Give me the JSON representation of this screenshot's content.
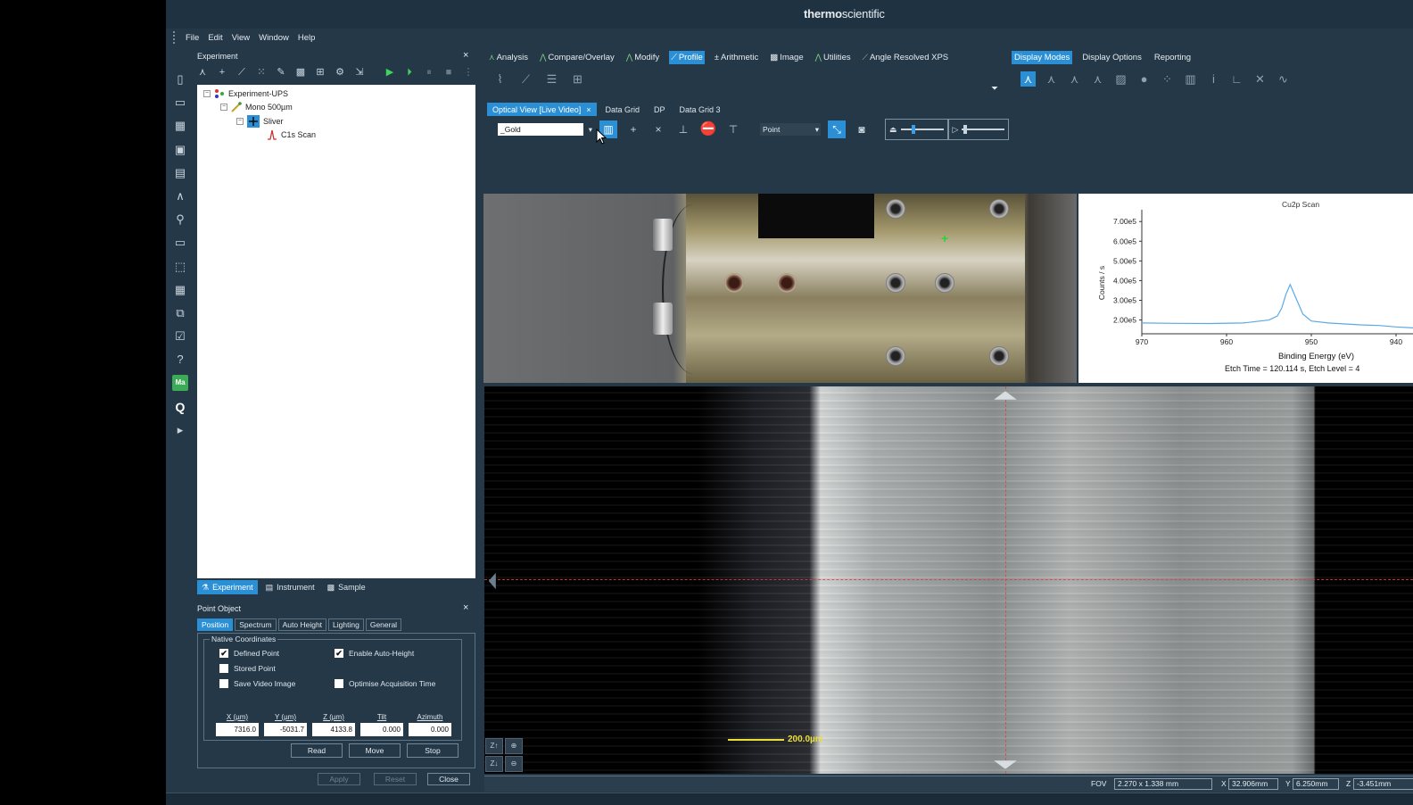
{
  "brand": {
    "part1": "thermo",
    "part2": "scientific"
  },
  "menu": [
    "File",
    "Edit",
    "View",
    "Window",
    "Help"
  ],
  "experiment_panel": {
    "title": "Experiment",
    "close": "×",
    "tree": [
      {
        "label": "Experiment-UPS"
      },
      {
        "label": "Mono 500µm"
      },
      {
        "label": "Sliver"
      },
      {
        "label": "C1s Scan"
      }
    ],
    "tabs": [
      "Experiment",
      "Instrument",
      "Sample"
    ]
  },
  "point_object": {
    "title": "Point Object",
    "close": "×",
    "tabs": [
      "Position",
      "Spectrum",
      "Auto Height",
      "Lighting",
      "General"
    ],
    "group_label": "Native Coordinates",
    "checkboxes": {
      "defined_point": {
        "label": "Defined Point",
        "checked": "✔"
      },
      "stored_point": {
        "label": "Stored Point",
        "checked": ""
      },
      "save_video_image": {
        "label": "Save Video Image",
        "checked": ""
      },
      "enable_auto_height": {
        "label": "Enable Auto-Height",
        "checked": "✔"
      },
      "optimise_acquisition": {
        "label": "Optimise Acquisition Time",
        "checked": ""
      }
    },
    "coords": [
      {
        "label": "X (µm)",
        "value": "7316.0"
      },
      {
        "label": "Y (µm)",
        "value": "-5031.7"
      },
      {
        "label": "Z (µm)",
        "value": "4133.8"
      },
      {
        "label": "Tilt",
        "value": "0.000"
      },
      {
        "label": "Azimuth",
        "value": "0.000"
      }
    ],
    "buttons": {
      "read": "Read",
      "move": "Move",
      "stop": "Stop",
      "apply": "Apply",
      "reset": "Reset",
      "close": "Close"
    }
  },
  "ribbon": {
    "tabs": [
      "Analysis",
      "Compare/Overlay",
      "Modify",
      "Profile",
      "Arithmetic",
      "Image",
      "Utilities",
      "Angle Resolved XPS"
    ],
    "active": "Profile",
    "right_tabs": [
      "Display Modes",
      "Display Options",
      "Reporting"
    ]
  },
  "doc_tabs": {
    "active": "Optical View [Live Video]",
    "close": "×",
    "others": [
      "Data Grid",
      "DP",
      "Data Grid 3"
    ]
  },
  "optical_toolbar": {
    "preset_value": "_Gold",
    "mode_value": "Point"
  },
  "scale_bar": {
    "label": "200.0µm"
  },
  "zoom_buttons": {
    "z_up": "Z↑",
    "z_down": "Z↓"
  },
  "status_bar": {
    "fov_label": "FOV",
    "fov_value": "2.270 x 1.338 mm",
    "x_label": "X",
    "x_value": "32.906mm",
    "y_label": "Y",
    "y_value": "6.250mm",
    "z_label": "Z",
    "z_value": "-3.451mm"
  },
  "chart_data": {
    "type": "line",
    "title": "Cu2p Scan",
    "xlabel": "Binding Energy (eV)",
    "ylabel": "Counts / s",
    "subtitle": "Etch Time = 120.114 s, Etch Level = 4",
    "x_ticks": [
      "970",
      "960",
      "950",
      "940"
    ],
    "y_ticks": [
      "7.00e5",
      "6.00e5",
      "5.00e5",
      "4.00e5",
      "3.00e5",
      "2.00e5"
    ],
    "xlim": [
      970,
      938
    ],
    "ylim": [
      130000.0,
      760000.0
    ],
    "series_color": "#5aa9e6",
    "x": [
      970,
      966,
      962,
      958,
      955,
      954,
      953.5,
      953,
      952.5,
      952,
      951,
      950,
      948,
      946,
      944,
      942,
      940,
      938
    ],
    "y": [
      185000,
      183000,
      182000,
      185000,
      200000,
      220000,
      260000,
      330000,
      380000,
      330000,
      230000,
      195000,
      185000,
      180000,
      175000,
      172000,
      165000,
      160000
    ]
  }
}
